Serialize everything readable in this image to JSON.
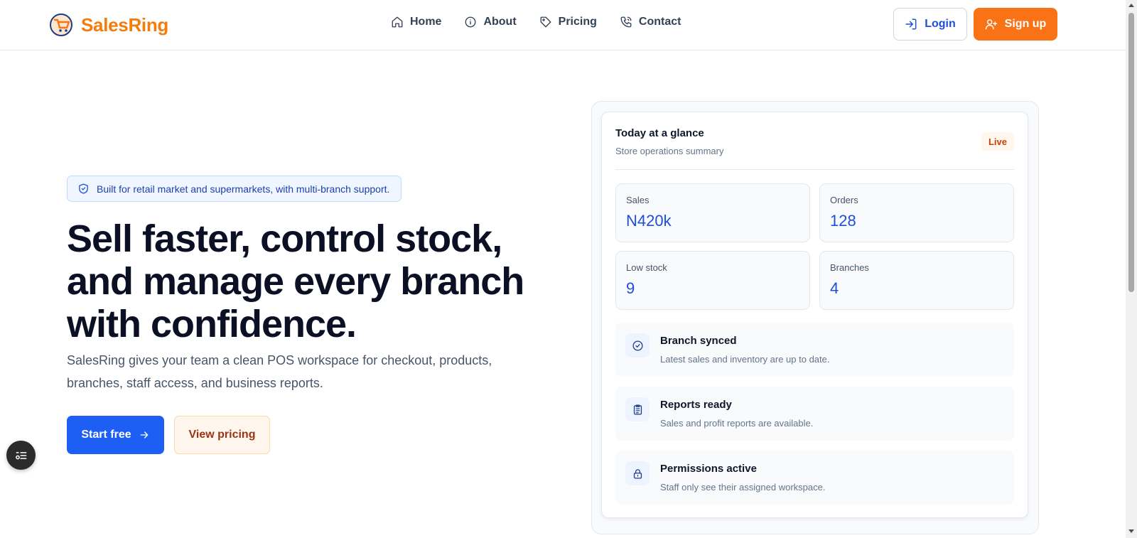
{
  "header": {
    "brand": "SalesRing",
    "nav": [
      {
        "label": "Home",
        "icon": "home-icon"
      },
      {
        "label": "About",
        "icon": "info-icon"
      },
      {
        "label": "Pricing",
        "icon": "tag-icon"
      },
      {
        "label": "Contact",
        "icon": "phone-icon"
      }
    ],
    "login_label": "Login",
    "signup_label": "Sign up"
  },
  "hero": {
    "badge": "Built for retail market and supermarkets, with multi-branch support.",
    "title": "Sell faster, control stock, and manage every branch with confidence.",
    "subtitle": "SalesRing gives your team a clean POS workspace for checkout, products, branches, staff access, and business reports.",
    "primary_cta": "Start free",
    "secondary_cta": "View pricing"
  },
  "glance": {
    "title": "Today at a glance",
    "subtitle": "Store operations summary",
    "live": "Live",
    "stats": [
      {
        "label": "Sales",
        "value": "N420k"
      },
      {
        "label": "Orders",
        "value": "128"
      },
      {
        "label": "Low stock",
        "value": "9"
      },
      {
        "label": "Branches",
        "value": "4"
      }
    ],
    "statuses": [
      {
        "title": "Branch synced",
        "desc": "Latest sales and inventory are up to date.",
        "icon": "check-circle-icon"
      },
      {
        "title": "Reports ready",
        "desc": "Sales and profit reports are available.",
        "icon": "clipboard-icon"
      },
      {
        "title": "Permissions active",
        "desc": "Staff only see their assigned workspace.",
        "icon": "lock-icon"
      }
    ]
  },
  "colors": {
    "brand_orange": "#f97316",
    "primary_blue": "#1d5ff5",
    "value_blue": "#1d4ed8"
  }
}
